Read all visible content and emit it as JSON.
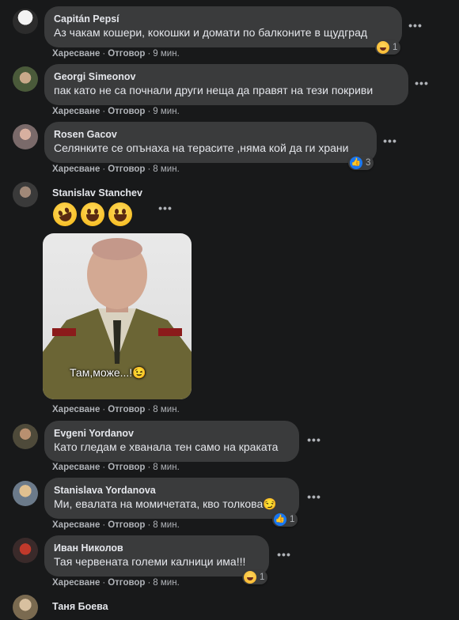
{
  "actions": {
    "like": "Харесване",
    "reply": "Отговор"
  },
  "comments": [
    {
      "author": "Capitán Pepsí",
      "text": "Аз чакам кошери, кокошки и домати по балконите в щудград",
      "time": "9 мин.",
      "reaction": {
        "icon": "haha-reaction-icon",
        "count": "1"
      }
    },
    {
      "author": "Georgi Simeonov",
      "text": "пак като не са почнали други неща да правят на тези покриви",
      "time": "9 мин."
    },
    {
      "author": "Rosen Gacov",
      "text": "Селянките се опънаха на терасите ,няма кой да ги храни",
      "time": "8 мин.",
      "reaction": {
        "icon": "like-reaction-icon",
        "count": "3"
      }
    },
    {
      "author": "Stanislav Stanchev",
      "emojis": [
        "rofl-emoji-icon",
        "grinning-emoji-icon",
        "laughing-emoji-icon"
      ],
      "image_caption": "Там,може...!😉",
      "time": "8 мин."
    },
    {
      "author": "Evgeni Yordanov",
      "text": "Като гледам е хванала тен само на краката",
      "time": "8 мин."
    },
    {
      "author": "Stanislava Yordanova",
      "text": "Ми, евалата на момичетата, кво толкова😏",
      "time": "8 мин.",
      "reaction": {
        "icon": "like-reaction-icon",
        "count": "1"
      }
    },
    {
      "author": "Иван Николов",
      "text": "Тая червената големи калници има!!!",
      "time": "8 мин.",
      "reaction": {
        "icon": "haha-reaction-icon",
        "count": "1"
      }
    },
    {
      "author": "Таня Боева"
    }
  ],
  "colors": {
    "background": "#18191a",
    "bubble": "#3a3b3c",
    "text": "#e4e6eb",
    "muted": "#b0b3b8",
    "like_blue": "#1877f2"
  }
}
